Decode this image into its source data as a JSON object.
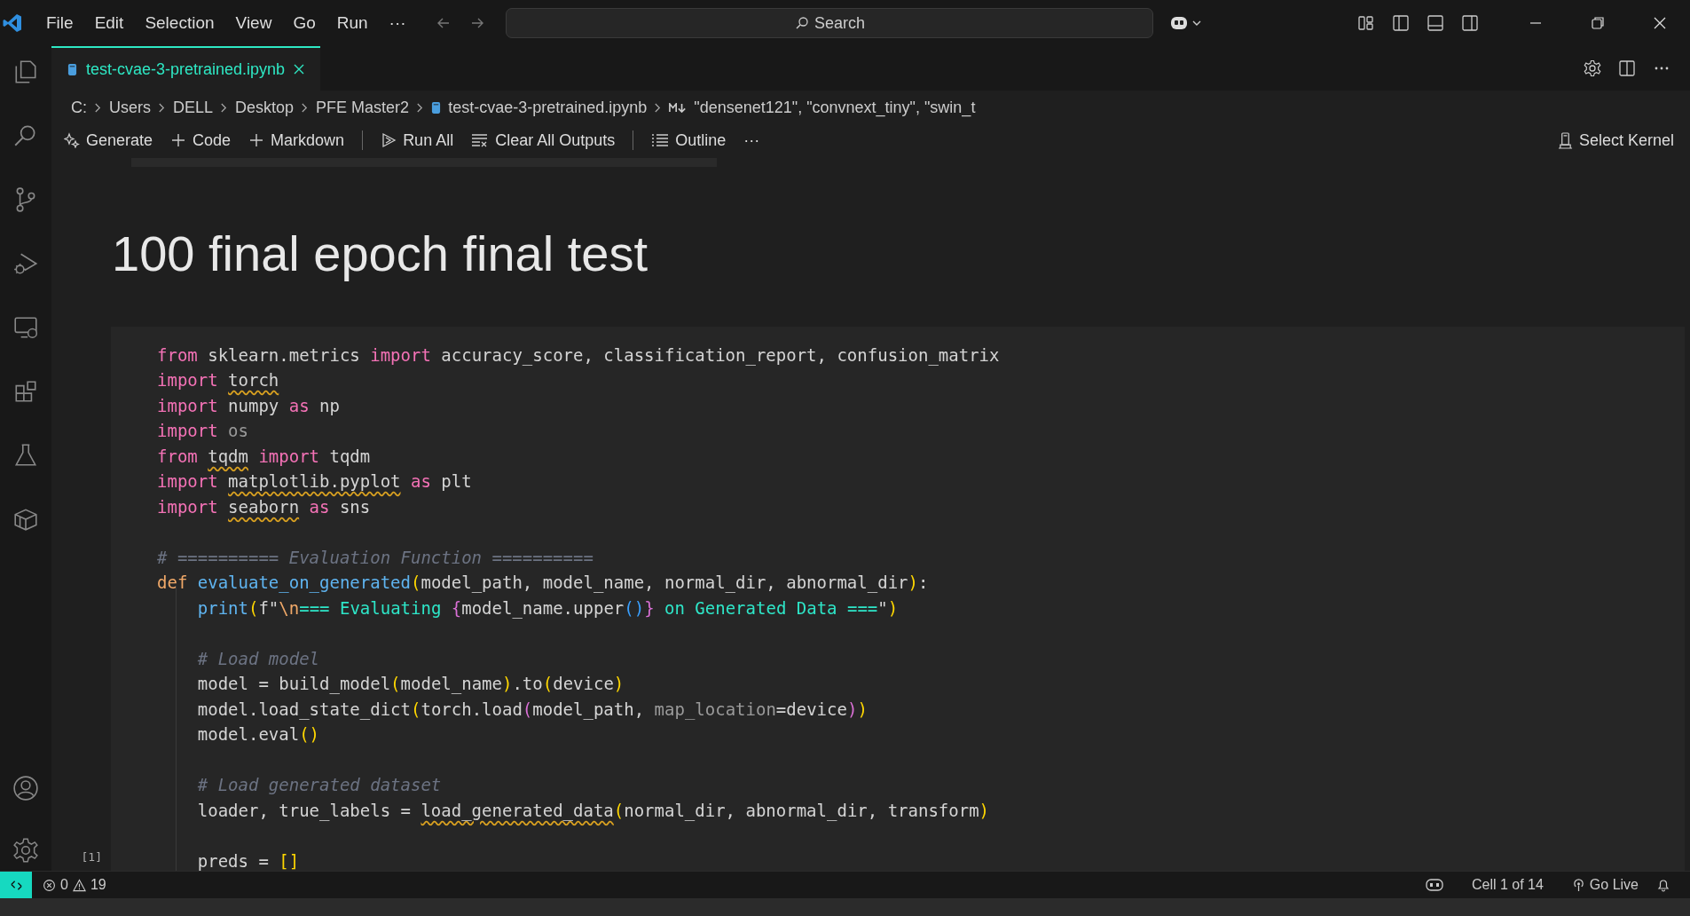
{
  "menu": [
    "File",
    "Edit",
    "Selection",
    "View",
    "Go",
    "Run",
    "···"
  ],
  "search": {
    "placeholder": "Search"
  },
  "activity_bar": [
    {
      "kind": "explorer"
    },
    {
      "kind": "search"
    },
    {
      "kind": "source-control"
    },
    {
      "kind": "run-debug"
    },
    {
      "kind": "remote"
    },
    {
      "kind": "extensions"
    },
    {
      "kind": "testing"
    },
    {
      "kind": "packages"
    }
  ],
  "activity_bottom": [
    {
      "kind": "account"
    },
    {
      "kind": "settings"
    }
  ],
  "tabs": [
    {
      "label": "test-cvae-3-pretrained.ipynb",
      "selected": true
    }
  ],
  "breadcrumb": [
    "C:",
    "Users",
    "DELL",
    "Desktop",
    "PFE Master2"
  ],
  "breadcrumb_file": "test-cvae-3-pretrained.ipynb",
  "breadcrumb_symbol": "\"densenet121\", \"convnext_tiny\", \"swin_t",
  "toolbar": [
    {
      "kind": "generate",
      "label": "Generate"
    },
    {
      "kind": "plus",
      "label": "Code"
    },
    {
      "kind": "plus",
      "label": "Markdown"
    },
    {
      "kind": "sep"
    },
    {
      "kind": "run",
      "label": "Run All"
    },
    {
      "kind": "clear",
      "label": "Clear All Outputs"
    },
    {
      "kind": "sep"
    },
    {
      "kind": "outline",
      "label": "Outline"
    },
    {
      "kind": "more",
      "label": "···"
    }
  ],
  "kernel": "Select Kernel",
  "heading": "100 final epoch final test",
  "cell_label": "[1]",
  "code": [
    {
      "gap_before": false,
      "tokens": [
        {
          "t": "from ",
          "kind": "kw"
        },
        {
          "t": "sklearn.metrics ",
          "kind": "p"
        },
        {
          "t": "import ",
          "kind": "kw"
        },
        {
          "t": "accuracy_score, classification_report, confusion_matrix",
          "kind": "p"
        }
      ]
    },
    {
      "gap_before": false,
      "tokens": [
        {
          "t": "import ",
          "kind": "kw"
        },
        {
          "t": "torch",
          "kind": "warn"
        }
      ]
    },
    {
      "gap_before": false,
      "tokens": [
        {
          "t": "import ",
          "kind": "kw"
        },
        {
          "t": "numpy ",
          "kind": "p"
        },
        {
          "t": "as ",
          "kind": "kw"
        },
        {
          "t": "np",
          "kind": "p"
        }
      ]
    },
    {
      "gap_before": false,
      "tokens": [
        {
          "t": "import ",
          "kind": "kw"
        },
        {
          "t": "os",
          "kind": "dim"
        }
      ]
    },
    {
      "gap_before": false,
      "tokens": [
        {
          "t": "from ",
          "kind": "kw"
        },
        {
          "t": "tqdm",
          "kind": "warn"
        },
        {
          "t": " import ",
          "kind": "kw"
        },
        {
          "t": "tqdm",
          "kind": "p"
        }
      ]
    },
    {
      "gap_before": false,
      "tokens": [
        {
          "t": "import ",
          "kind": "kw"
        },
        {
          "t": "matplotlib.pyplot",
          "kind": "warn"
        },
        {
          "t": " as ",
          "kind": "kw"
        },
        {
          "t": "plt",
          "kind": "p"
        }
      ]
    },
    {
      "gap_before": false,
      "tokens": [
        {
          "t": "import ",
          "kind": "kw"
        },
        {
          "t": "seaborn",
          "kind": "warn"
        },
        {
          "t": " as ",
          "kind": "kw"
        },
        {
          "t": "sns",
          "kind": "p"
        }
      ]
    },
    {
      "gap_before": true,
      "tokens": [
        {
          "t": "# ========== Evaluation Function ==========",
          "kind": "comment"
        }
      ]
    },
    {
      "gap_before": false,
      "tokens": [
        {
          "t": "def ",
          "kind": "def"
        },
        {
          "t": "evaluate_on_generated",
          "kind": "fn"
        },
        {
          "t": "(",
          "kind": "b1"
        },
        {
          "t": "model_path, model_name, normal_dir, abnormal_dir",
          "kind": "p"
        },
        {
          "t": ")",
          "kind": "b1"
        },
        {
          "t": ":",
          "kind": "p"
        }
      ]
    },
    {
      "gap_before": false,
      "tokens": [
        {
          "t": "    print",
          "kind": "fn"
        },
        {
          "t": "(",
          "kind": "b1"
        },
        {
          "t": "f\"",
          "kind": "p"
        },
        {
          "t": "\\n",
          "kind": "def"
        },
        {
          "t": "=== Evaluating ",
          "kind": "str"
        },
        {
          "t": "{",
          "kind": "b2"
        },
        {
          "t": "model_name.upper",
          "kind": "p"
        },
        {
          "t": "()",
          "kind": "b3"
        },
        {
          "t": "}",
          "kind": "b2"
        },
        {
          "t": " on Generated Data ===",
          "kind": "str"
        },
        {
          "t": "\"",
          "kind": "p"
        },
        {
          "t": ")",
          "kind": "b1"
        }
      ]
    },
    {
      "gap_before": true,
      "tokens": [
        {
          "t": "    # Load model",
          "kind": "comment"
        }
      ]
    },
    {
      "gap_before": false,
      "tokens": [
        {
          "t": "    model = build_model",
          "kind": "p"
        },
        {
          "t": "(",
          "kind": "b1"
        },
        {
          "t": "model_name",
          "kind": "p"
        },
        {
          "t": ")",
          "kind": "b1"
        },
        {
          "t": ".to",
          "kind": "p"
        },
        {
          "t": "(",
          "kind": "b1"
        },
        {
          "t": "device",
          "kind": "p"
        },
        {
          "t": ")",
          "kind": "b1"
        }
      ]
    },
    {
      "gap_before": false,
      "tokens": [
        {
          "t": "    model.load_state_dict",
          "kind": "p"
        },
        {
          "t": "(",
          "kind": "b1"
        },
        {
          "t": "torch.load",
          "kind": "p"
        },
        {
          "t": "(",
          "kind": "b2"
        },
        {
          "t": "model_path, ",
          "kind": "p"
        },
        {
          "t": "map_location",
          "kind": "dim"
        },
        {
          "t": "=device",
          "kind": "p"
        },
        {
          "t": ")",
          "kind": "b2"
        },
        {
          "t": ")",
          "kind": "b1"
        }
      ]
    },
    {
      "gap_before": false,
      "tokens": [
        {
          "t": "    model.eval",
          "kind": "p"
        },
        {
          "t": "()",
          "kind": "b1"
        }
      ]
    },
    {
      "gap_before": true,
      "tokens": [
        {
          "t": "    # Load generated dataset",
          "kind": "comment"
        }
      ]
    },
    {
      "gap_before": false,
      "tokens": [
        {
          "t": "    loader, true_labels = ",
          "kind": "p"
        },
        {
          "t": "load_generated_data",
          "kind": "warn"
        },
        {
          "t": "(",
          "kind": "b1"
        },
        {
          "t": "normal_dir, abnormal_dir, transform",
          "kind": "p"
        },
        {
          "t": ")",
          "kind": "b1"
        }
      ]
    },
    {
      "gap_before": true,
      "tokens": [
        {
          "t": "    preds = ",
          "kind": "p"
        },
        {
          "t": "[]",
          "kind": "b1"
        }
      ]
    }
  ],
  "status": {
    "errors": "0",
    "warnings": "19",
    "cell": "Cell 1 of 14",
    "live": "Go Live"
  }
}
